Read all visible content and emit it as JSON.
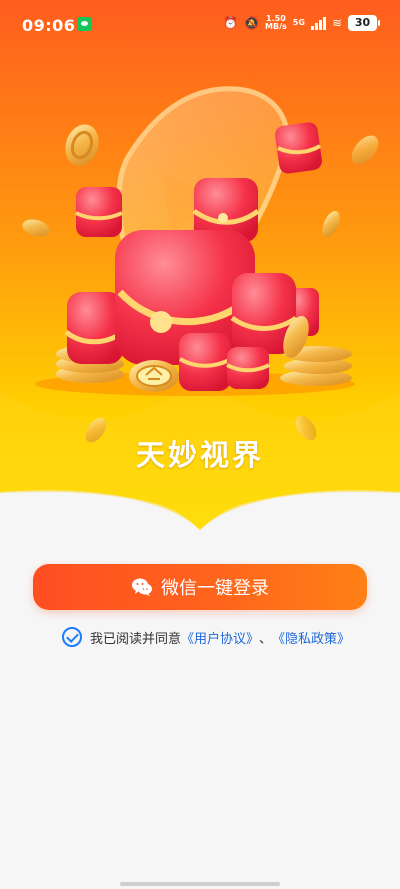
{
  "status_bar": {
    "time": "09:06",
    "network_speed_value": "1.50",
    "network_speed_unit": "MB/s",
    "network_type": "5G",
    "battery": "30"
  },
  "app": {
    "name": "天妙视界"
  },
  "login": {
    "button_label": "微信一键登录"
  },
  "agreement": {
    "prefix": "我已阅读并同意",
    "user_agreement": "《用户协议》",
    "separator": "、",
    "privacy_policy": "《隐私政策》"
  },
  "colors": {
    "hero_orange": "#ff6d18",
    "hero_yellow": "#ffe000",
    "button_orange": "#ff5a20",
    "link_blue": "#2068d8",
    "check_blue": "#1a7cff"
  }
}
